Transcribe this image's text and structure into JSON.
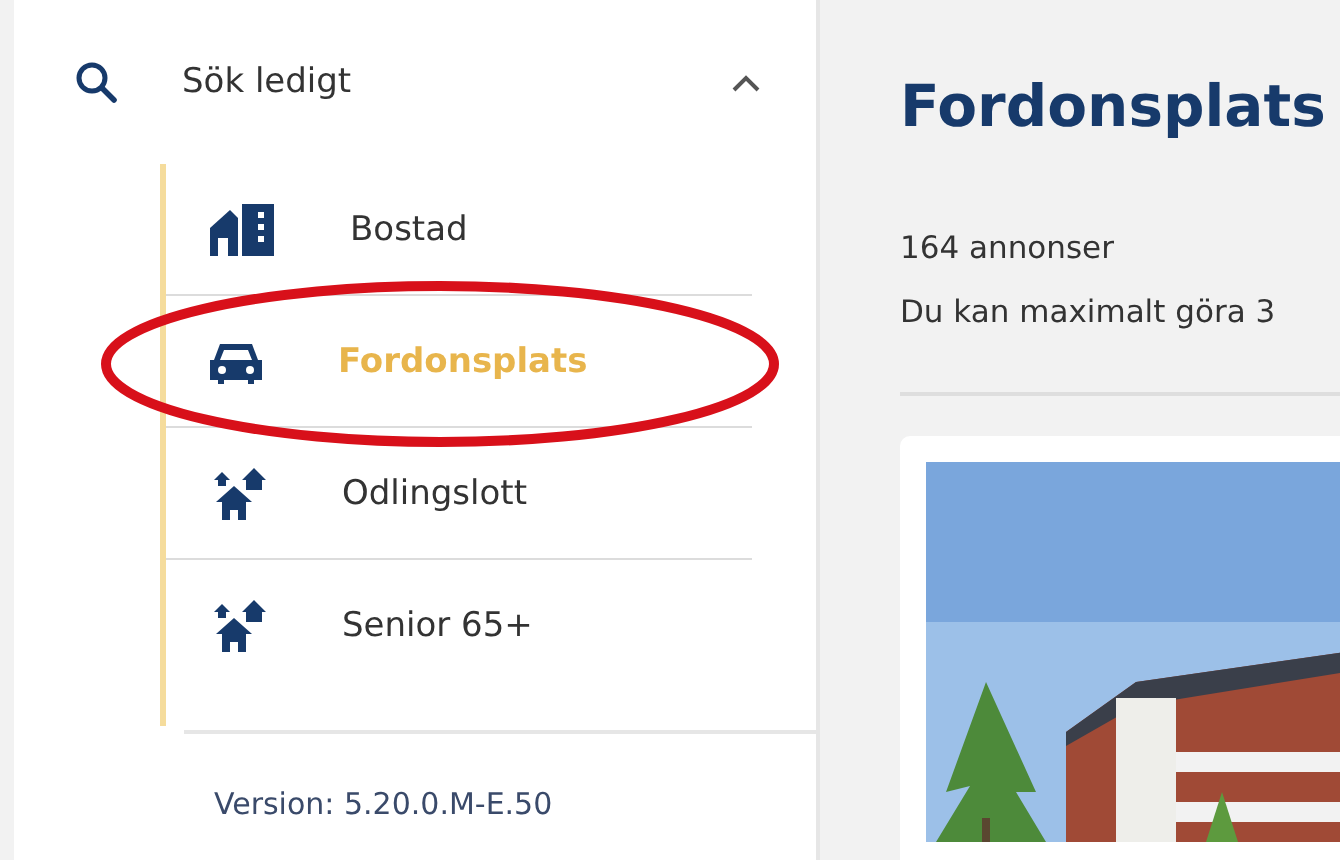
{
  "sidebar": {
    "section": {
      "label": "Sök ledigt",
      "expanded": true
    },
    "items": [
      {
        "label": "Bostad",
        "kind": "building",
        "selected": false
      },
      {
        "label": "Fordonsplats",
        "kind": "car",
        "selected": true
      },
      {
        "label": "Odlingslott",
        "kind": "houses",
        "selected": false
      },
      {
        "label": "Senior 65+",
        "kind": "houses",
        "selected": false
      }
    ],
    "version": "Version: 5.20.0.M-E.50"
  },
  "main": {
    "title": "Fordonsplats",
    "count": "164 annonser",
    "note": "Du kan maximalt göra 3"
  }
}
